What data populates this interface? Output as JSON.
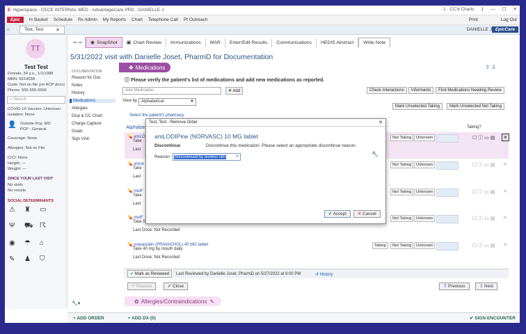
{
  "titlebar": {
    "app": "Hyperspace - CECE INTERNAL MED - AdvantageCare PRD - DANIELLE J.",
    "ccd": "1 · CC'd Charts",
    "count": "1"
  },
  "menubar": {
    "epic": "Epic",
    "items": [
      "In Basket",
      "Schedule",
      "Rx Admin",
      "My Reports",
      "Chart",
      "Telephone Call",
      "Pt Outreach"
    ],
    "print": "Print",
    "logout": "Log Out"
  },
  "patienttab": {
    "label": "Test, Test",
    "user": "DANIELLE J.",
    "brand": "EpicCare"
  },
  "toolbar": {
    "items": [
      "SnapShot",
      "Chart Review",
      "Immunizations",
      "MAR",
      "Enter/Edit Results",
      "Communications",
      "HEDIS Abstract",
      "Write Note"
    ]
  },
  "patient": {
    "initials": "TT",
    "name": "Test Test",
    "demo": "Female, 34 y.o., 1/1/1988",
    "mrn": "MRN: 6619038",
    "code": "Code: Not on file (no ACP docs)",
    "phone": "Phone: 555-555-5555",
    "search": "Search",
    "covid": "COVID-19 Vaccine: Unknown",
    "isolation": "Isolation: None",
    "pcp": "Outside Pcp, MD",
    "pcprole": "PCP - General",
    "coverage": "Coverage: None",
    "allergies": "Allergies: Not on File",
    "crcl": "CrCl: None",
    "height": "Height: —",
    "weight": "Weight: —",
    "since": "SINCE YOUR LAST VISIT",
    "novisits": "No visits",
    "noresults": "No results",
    "sdoh": "SOCIAL DETERMINANTS"
  },
  "menu": {
    "header": "DOCUMENTATION",
    "items": [
      "Reason for Doc",
      "Notes",
      "History",
      "Medications",
      "Allergies",
      "Disp & CC Chart",
      "Charge Capture",
      "Goals",
      "Sign Visit"
    ]
  },
  "visit": {
    "title": "5/31/2022 visit with Danielle Joset, PharmD for Documentation"
  },
  "meds": {
    "header": "Medications",
    "instruction": "Please verify the patient's list of medications and add new medications as reported.",
    "add_placeholder": "Add Medication",
    "add_btn": "Add",
    "viewby": "View by:",
    "viewby_val": "Alphabetical",
    "pharmacy": "Select the patient's pharmacy",
    "alphabet": "Alphabe",
    "taking_q": "Taking?",
    "btns": [
      "Check Interactions",
      "Informants",
      "Find Medications Needing Review",
      "Mark Unselected Taking",
      "Mark Unselected Not Taking"
    ],
    "rows": [
      {
        "name": "amLO",
        "sig": "Take",
        "last": "Last"
      },
      {
        "name": "amox",
        "sig": "Take",
        "last": "Last"
      },
      {
        "name": "metF",
        "sig": "Take",
        "last": "Last"
      },
      {
        "name": "metF",
        "sig": "Take 5",
        "last": "Last Dose: Not Recorded"
      },
      {
        "name": "pravastatin (PRAVACHOL) 40 MG tablet",
        "sig": "Take 40 mg by mouth daily",
        "last": "Last Dose: Not Recorded"
      }
    ],
    "taking": "Taking",
    "nottaking": "Not Taking",
    "unknown": "Unknown",
    "reviewed_btn": "Mark as Reviewed",
    "reviewed_text": "Last Reviewed by Danielle Joset, PharmD on 5/27/2022 at 6:00 PM",
    "history": "History",
    "restore": "Restore",
    "close": "Close",
    "previous": "Previous",
    "next": "Next",
    "allergies": "Allergies/Contraindications"
  },
  "modal": {
    "title": "Test, Test - Remove Order",
    "drug": "amLODIPine (NORVASC) 10 MG tablet",
    "action": "Discontinue",
    "msg": "Discontinue this medication. Please select an appropriate discontinue reason.",
    "reason_label": "Reason:",
    "reason_value": "Discontinued by another clin",
    "accept": "Accept",
    "cancel": "Cancel"
  },
  "bottom": {
    "order": "+ ADD ORDER",
    "dx": "+ ADD DX (0)",
    "sign": "SIGN ENCOUNTER"
  },
  "colors": {
    "purple": "#9b4fa3",
    "blue": "#2058a8",
    "epic_red": "#c41e3a"
  }
}
